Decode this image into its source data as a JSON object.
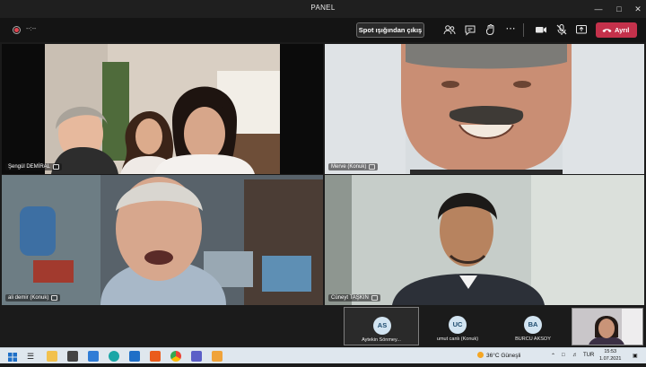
{
  "window": {
    "title": "PANEL"
  },
  "toolbar": {
    "recording_timer": "--:--",
    "spotlight_exit_label": "Spot ışığından çıkış",
    "leave_label": "Ayrıl"
  },
  "participants": [
    {
      "name": "Şengül DEMİRAL"
    },
    {
      "name": "Merve (Konuk)"
    },
    {
      "name": "ali demir (Konuk)"
    },
    {
      "name": "Cüneyt TAŞKIN"
    }
  ],
  "attendees": [
    {
      "initials": "AS",
      "name": "Aytekin Sönmey..."
    },
    {
      "initials": "UC",
      "name": "umut canlı (Konuk)"
    },
    {
      "initials": "BA",
      "name": "BURCU AKSOY"
    }
  ],
  "taskbar": {
    "weather": "36°C  Güneşli",
    "language": "TUR",
    "time": "15:53",
    "date": "1.07.2021"
  },
  "colors": {
    "leave": "#c4314b",
    "avatar_bg": "#d2e4f1"
  }
}
